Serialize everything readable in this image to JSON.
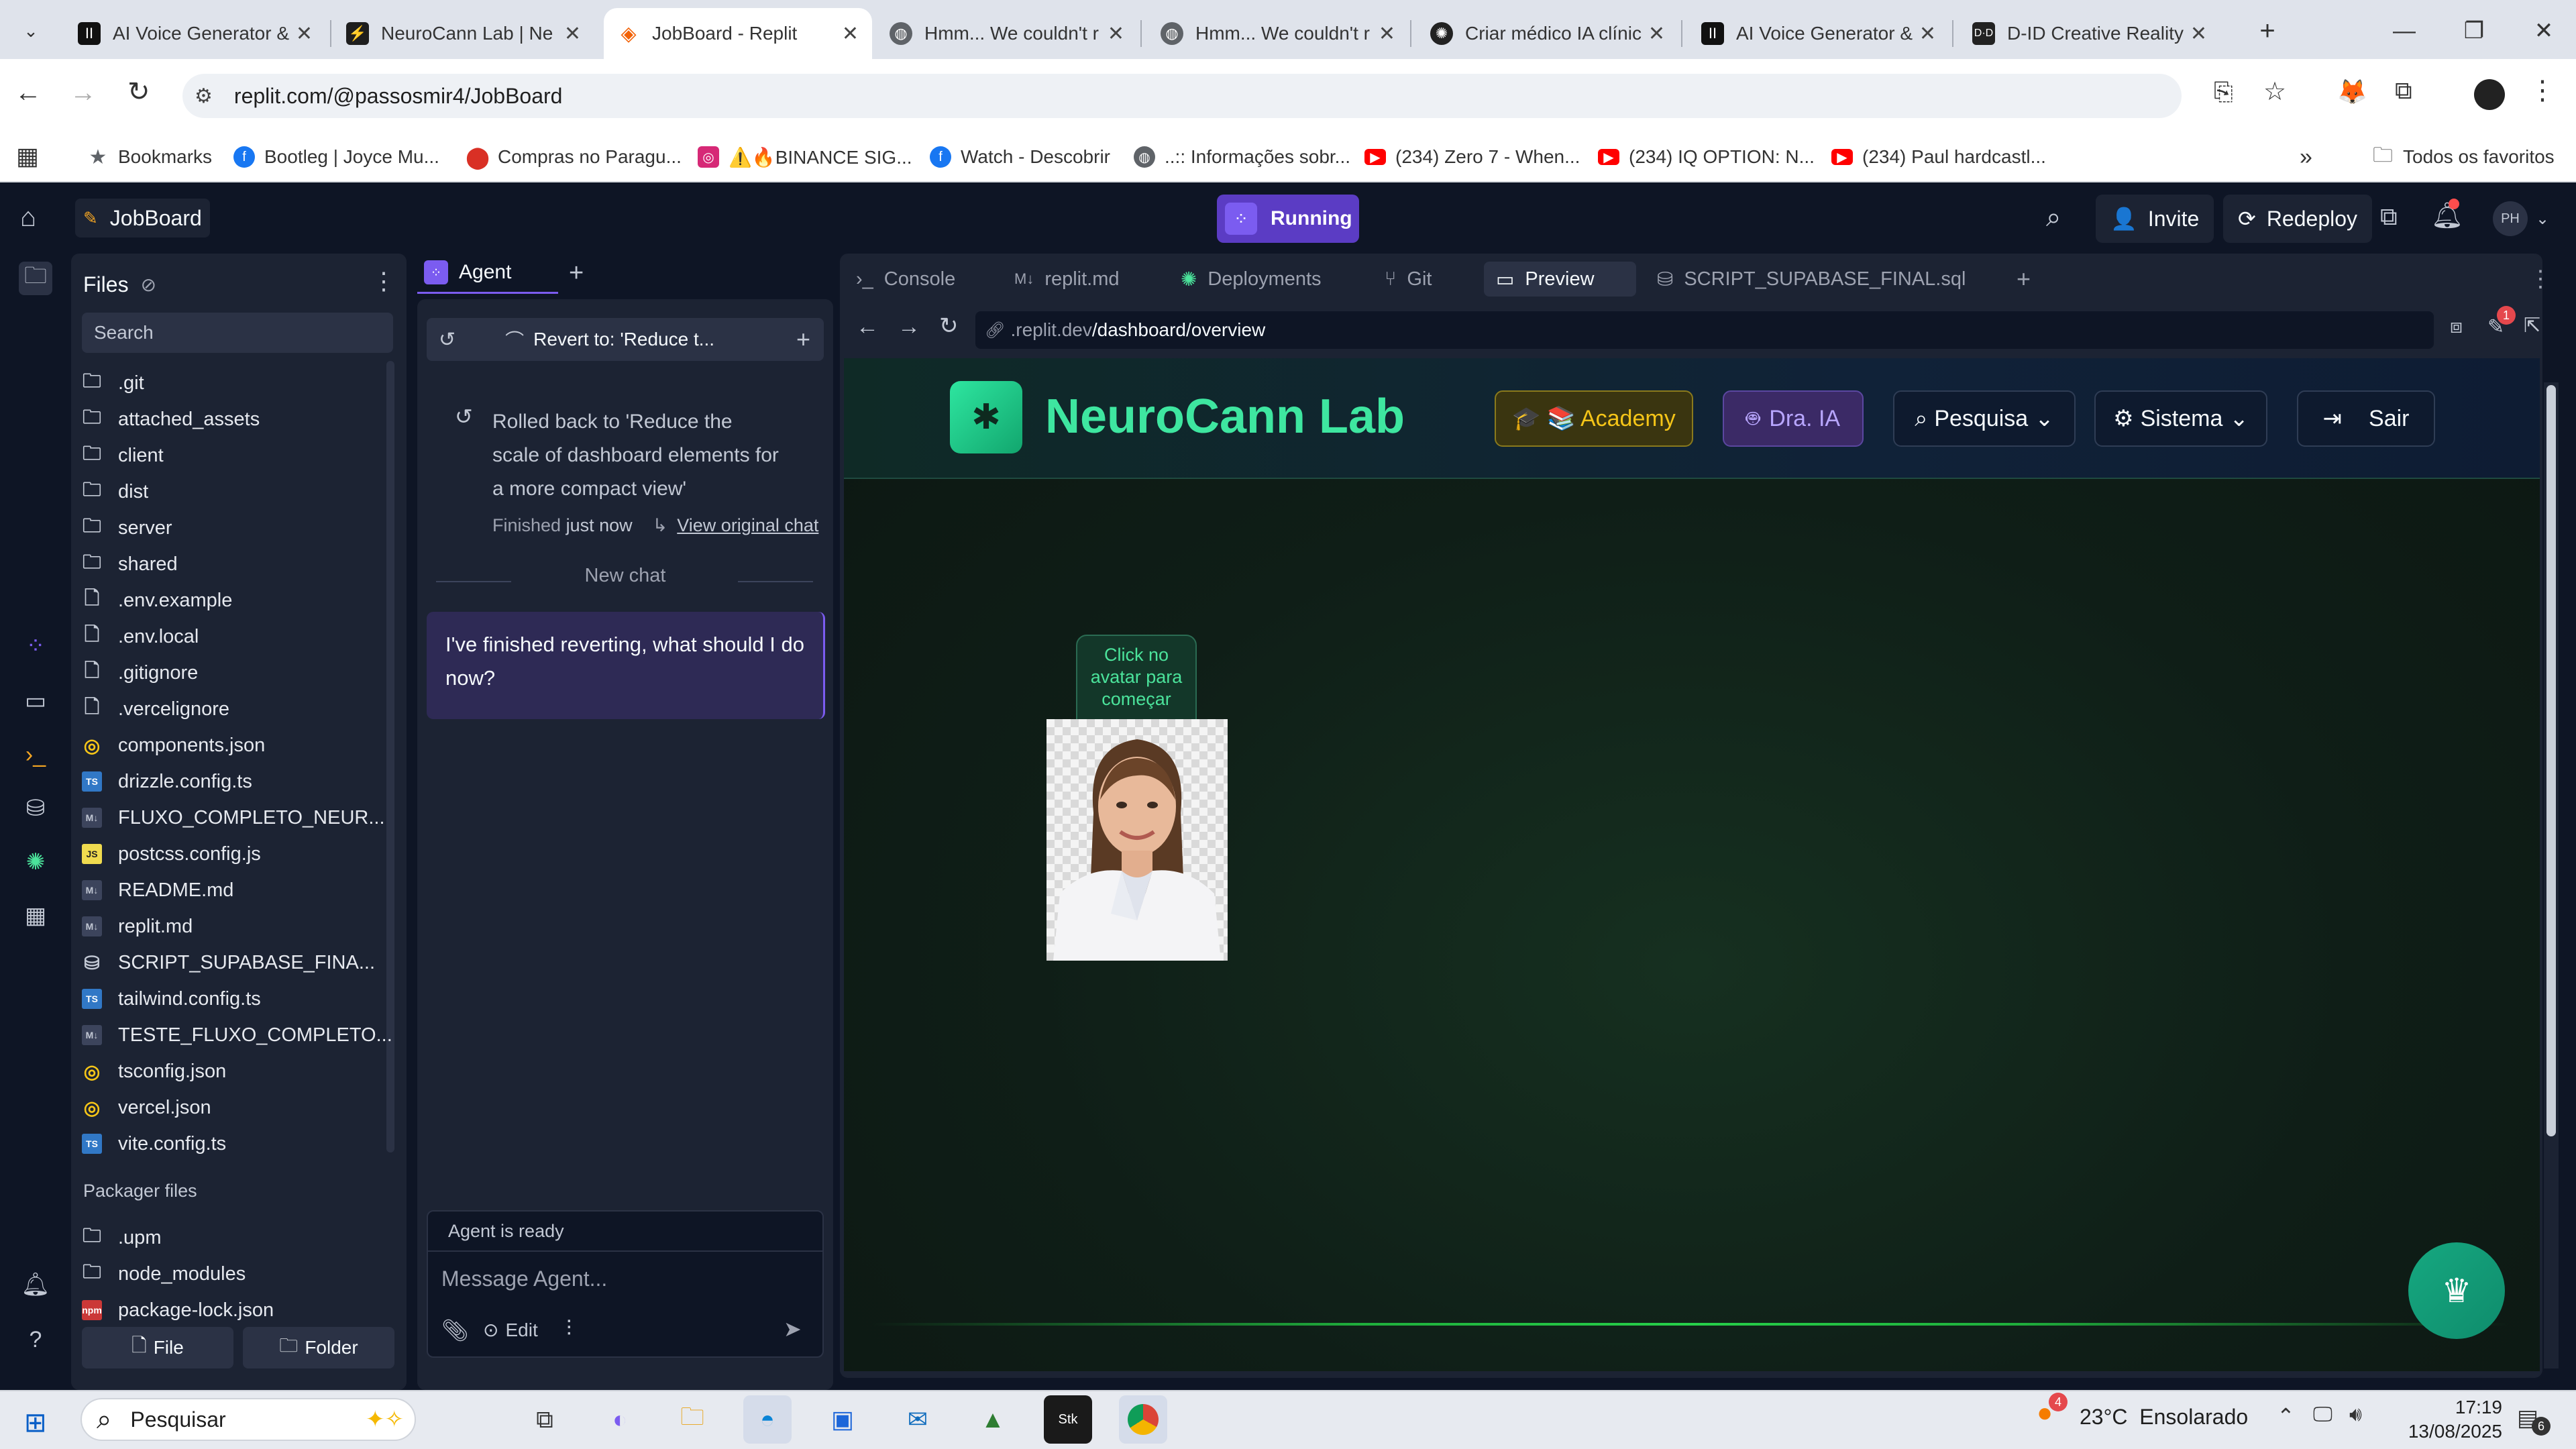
{
  "browser": {
    "tabs": [
      {
        "title": "AI Voice Generator & ",
        "icon": "pause-icon",
        "color": "#111111"
      },
      {
        "title": "NeuroCann Lab | Ne",
        "icon": "bolt-icon",
        "color": "#1e1e1e"
      },
      {
        "title": "JobBoard - Replit",
        "icon": "replit-icon",
        "color": "#f26207"
      },
      {
        "title": "Hmm... We couldn't r",
        "icon": "globe-icon",
        "color": "#5f6368"
      },
      {
        "title": "Hmm... We couldn't r",
        "icon": "globe-icon",
        "color": "#5f6368"
      },
      {
        "title": "Criar médico IA clínic",
        "icon": "openai-icon",
        "color": "#222222"
      },
      {
        "title": "AI Voice Generator & ",
        "icon": "pause-icon",
        "color": "#111111"
      },
      {
        "title": "D-ID Creative Reality",
        "icon": "did-icon",
        "color": "#222222"
      }
    ],
    "url": "replit.com/@passosmir4/JobBoard",
    "bookmarks": [
      {
        "label": "Bookmarks",
        "icon": "star-icon",
        "color": "#5f6368"
      },
      {
        "label": "Bootleg | Joyce Mu...",
        "icon": "facebook-icon",
        "color": "#1877f2"
      },
      {
        "label": "Compras no Paragu...",
        "icon": "pin-icon",
        "color": "#d93025"
      },
      {
        "label": "⚠️🔥BINANCE SIG...",
        "icon": "instagram-icon",
        "color": "#d62976"
      },
      {
        "label": "Watch - Descobrir",
        "icon": "facebook-icon",
        "color": "#1877f2"
      },
      {
        "label": "..:: Informações sobr...",
        "icon": "globe-icon",
        "color": "#5f6368"
      },
      {
        "label": "(234) Zero 7 - When...",
        "icon": "youtube-icon",
        "color": "#ff0000"
      },
      {
        "label": "(234) IQ OPTION: N...",
        "icon": "youtube-icon",
        "color": "#ff0000"
      },
      {
        "label": "(234) Paul hardcastl...",
        "icon": "youtube-icon",
        "color": "#ff0000"
      }
    ],
    "all_bookmarks": "Todos os favoritos"
  },
  "replit": {
    "project": "JobBoard",
    "status": "Running",
    "invite": "Invite",
    "redeploy": "Redeploy",
    "avatar": "PH",
    "notif_badge": "1",
    "files": {
      "title": "Files",
      "search_placeholder": "Search",
      "items": [
        {
          "name": ".git",
          "type": "folder"
        },
        {
          "name": "attached_assets",
          "type": "folder"
        },
        {
          "name": "client",
          "type": "folder"
        },
        {
          "name": "dist",
          "type": "folder"
        },
        {
          "name": "server",
          "type": "folder"
        },
        {
          "name": "shared",
          "type": "folder"
        },
        {
          "name": ".env.example",
          "type": "file"
        },
        {
          "name": ".env.local",
          "type": "file"
        },
        {
          "name": ".gitignore",
          "type": "file"
        },
        {
          "name": ".vercelignore",
          "type": "file"
        },
        {
          "name": "components.json",
          "type": "json"
        },
        {
          "name": "drizzle.config.ts",
          "type": "ts"
        },
        {
          "name": "FLUXO_COMPLETO_NEUR...",
          "type": "md"
        },
        {
          "name": "postcss.config.js",
          "type": "js"
        },
        {
          "name": "README.md",
          "type": "md"
        },
        {
          "name": "replit.md",
          "type": "md"
        },
        {
          "name": "SCRIPT_SUPABASE_FINA...",
          "type": "sql"
        },
        {
          "name": "tailwind.config.ts",
          "type": "ts"
        },
        {
          "name": "TESTE_FLUXO_COMPLETO...",
          "type": "md"
        },
        {
          "name": "tsconfig.json",
          "type": "json"
        },
        {
          "name": "vercel.json",
          "type": "json"
        },
        {
          "name": "vite.config.ts",
          "type": "ts"
        }
      ],
      "packager_title": "Packager files",
      "packager_items": [
        {
          "name": ".upm",
          "type": "folder"
        },
        {
          "name": "node_modules",
          "type": "folder"
        },
        {
          "name": "package-lock.json",
          "type": "npm"
        }
      ],
      "new_file": "File",
      "new_folder": "Folder"
    },
    "agent": {
      "tab": "Agent",
      "revert_label": "Revert to: 'Reduce t...",
      "rollback_text": "Rolled back to 'Reduce the scale of dashboard elements for a more compact view'",
      "finished": "Finished",
      "finished_time": "just now",
      "view_original": "View original chat",
      "new_chat": "New chat",
      "message": "I've finished reverting, what should I do now?",
      "ready": "Agent is ready",
      "input_placeholder": "Message Agent...",
      "edit": "Edit"
    },
    "pane_tabs": [
      "Console",
      "replit.md",
      "Deployments",
      "Git",
      "Preview",
      "SCRIPT_SUPABASE_FINAL.sql"
    ],
    "preview_url_prefix": ".replit.dev",
    "preview_url_path": "/dashboard/overview",
    "preview_badge": "1"
  },
  "site": {
    "brand": "NeuroCann Lab",
    "nav": {
      "academy": "🎓 📚 Academy",
      "dra": "Dra. IA",
      "pesquisa": "Pesquisa",
      "sistema": "Sistema",
      "sair": "Sair"
    },
    "avatar_tooltip": "Click no avatar para começar"
  },
  "taskbar": {
    "search": "Pesquisar",
    "weather_badge": "4",
    "weather": "23°C  Ensolarado",
    "time": "17:19",
    "date": "13/08/2025",
    "notif_badge": "6"
  },
  "colors": {
    "replit_bg": "#0e1525",
    "panel_bg": "#1c2333",
    "running": "#5b3cc4",
    "brand_green": "#3ee6a0",
    "academy_bg": "#3a3510",
    "dra_bg": "#3b2a66"
  }
}
